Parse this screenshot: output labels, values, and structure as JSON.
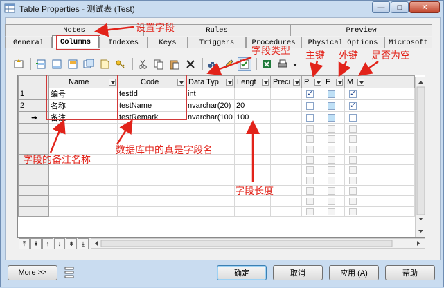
{
  "window": {
    "title": "Table Properties - 测试表 (Test)",
    "min": "—",
    "max": "□",
    "close": "✕"
  },
  "tabs_top": [
    "Notes",
    "Rules",
    "Preview"
  ],
  "tabs_bottom": [
    "General",
    "Columns",
    "Indexes",
    "Keys",
    "Triggers",
    "Procedures",
    "Physical Options",
    "Microsoft"
  ],
  "active_tab": "Columns",
  "grid": {
    "headers": [
      "",
      "Name",
      "Code",
      "Data Typ",
      "Lengt",
      "Preci",
      "P",
      "F",
      "M"
    ],
    "rows": [
      {
        "num": "1",
        "name": "编号",
        "code": "testId",
        "type": "int",
        "length": "",
        "p": true,
        "f": false,
        "m": true
      },
      {
        "num": "2",
        "name": "名称",
        "code": "testName",
        "type": "nvarchar(20)",
        "length": "20",
        "p": false,
        "f": false,
        "m": true
      },
      {
        "num": "➜",
        "name": "备注",
        "code": "testRemark",
        "type": "nvarchar(100",
        "length": "100",
        "p": false,
        "f": false,
        "m": false
      }
    ]
  },
  "buttons": {
    "more": "More >>",
    "ok": "确定",
    "cancel": "取消",
    "apply": "应用 (A)",
    "help": "帮助"
  },
  "annotations": {
    "set_field": "设置字段",
    "field_type": "字段类型",
    "pk": "主键",
    "fk": "外键",
    "nullable": "是否为空",
    "remark_name": "字段的备注名称",
    "real_field_name": "数据库中的真是字段名",
    "field_length": "字段长度"
  },
  "colors": {
    "annotation": "#e2231a",
    "window_bg": "#c9dcf0"
  }
}
